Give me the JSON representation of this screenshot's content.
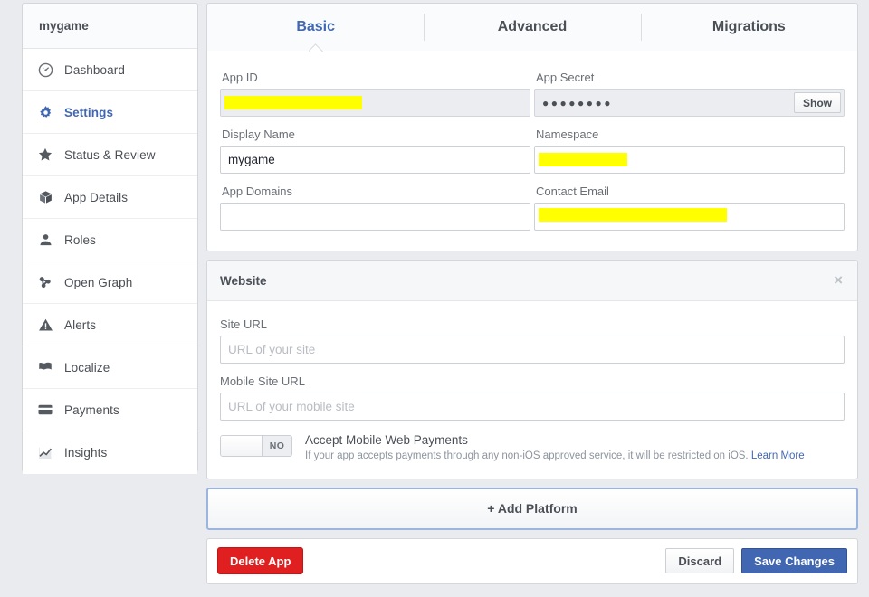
{
  "sidebar": {
    "app_title": "mygame",
    "items": [
      {
        "label": "Dashboard",
        "icon": "gauge-icon",
        "active": false
      },
      {
        "label": "Settings",
        "icon": "gear-icon",
        "active": true
      },
      {
        "label": "Status & Review",
        "icon": "star-icon",
        "active": false
      },
      {
        "label": "App Details",
        "icon": "cube-icon",
        "active": false
      },
      {
        "label": "Roles",
        "icon": "person-icon",
        "active": false
      },
      {
        "label": "Open Graph",
        "icon": "graph-icon",
        "active": false
      },
      {
        "label": "Alerts",
        "icon": "warning-icon",
        "active": false
      },
      {
        "label": "Localize",
        "icon": "flag-icon",
        "active": false
      },
      {
        "label": "Payments",
        "icon": "credit-card-icon",
        "active": false
      },
      {
        "label": "Insights",
        "icon": "chart-line-icon",
        "active": false
      }
    ]
  },
  "tabs": [
    {
      "label": "Basic",
      "active": true
    },
    {
      "label": "Advanced",
      "active": false
    },
    {
      "label": "Migrations",
      "active": false
    }
  ],
  "basic": {
    "app_id": {
      "label": "App ID",
      "value": "",
      "redacted": true,
      "disabled": true
    },
    "app_secret": {
      "label": "App Secret",
      "value": "●●●●●●●●",
      "show_button": "Show",
      "disabled": true
    },
    "display_name": {
      "label": "Display Name",
      "value": "mygame"
    },
    "namespace": {
      "label": "Namespace",
      "value": "",
      "redacted": true
    },
    "app_domains": {
      "label": "App Domains",
      "value": ""
    },
    "contact_email": {
      "label": "Contact Email",
      "value": "",
      "redacted": true
    }
  },
  "website": {
    "header": "Website",
    "close_label": "×",
    "site_url": {
      "label": "Site URL",
      "value": "",
      "placeholder": "URL of your site"
    },
    "mobile_site_url": {
      "label": "Mobile Site URL",
      "value": "",
      "placeholder": "URL of your mobile site"
    },
    "toggle": {
      "state": "NO",
      "title": "Accept Mobile Web Payments",
      "description": "If your app accepts payments through any non-iOS approved service, it will be restricted on iOS.",
      "link": "Learn More"
    }
  },
  "add_platform": {
    "label": "+ Add Platform"
  },
  "footer": {
    "delete_label": "Delete App",
    "discard_label": "Discard",
    "save_label": "Save Changes"
  },
  "colors": {
    "accent": "#4267b2",
    "page_bg": "#e9ebee",
    "danger": "#e02020",
    "redaction": "#ffff00",
    "add_platform_border": "#9cb4e0"
  }
}
